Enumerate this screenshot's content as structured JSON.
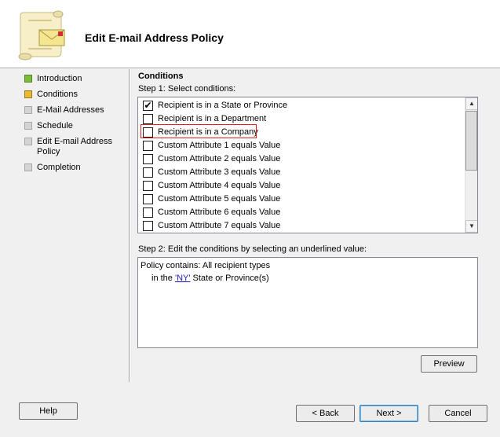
{
  "window": {
    "title": "Edit E-mail Address Policy",
    "header_icon": "scroll-envelope-icon"
  },
  "steps": [
    {
      "label": "Introduction",
      "state": "done"
    },
    {
      "label": "Conditions",
      "state": "current"
    },
    {
      "label": "E-Mail Addresses",
      "state": "pending"
    },
    {
      "label": "Schedule",
      "state": "pending"
    },
    {
      "label": "Edit E-mail Address Policy",
      "state": "pending"
    },
    {
      "label": "Completion",
      "state": "pending"
    }
  ],
  "conditions": {
    "section_title": "Conditions",
    "step1_label": "Step 1: Select conditions:",
    "items": [
      {
        "label": "Recipient is in a State or Province",
        "checked": true
      },
      {
        "label": "Recipient is in a Department",
        "checked": false
      },
      {
        "label": "Recipient is in a Company",
        "checked": false,
        "highlighted": true
      },
      {
        "label": "Custom Attribute 1 equals Value",
        "checked": false
      },
      {
        "label": "Custom Attribute 2 equals Value",
        "checked": false
      },
      {
        "label": "Custom Attribute 3 equals Value",
        "checked": false
      },
      {
        "label": "Custom Attribute 4 equals Value",
        "checked": false
      },
      {
        "label": "Custom Attribute 5 equals Value",
        "checked": false
      },
      {
        "label": "Custom Attribute 6 equals Value",
        "checked": false
      },
      {
        "label": "Custom Attribute 7 equals Value",
        "checked": false
      }
    ],
    "step2_label": "Step 2: Edit the conditions by selecting an underlined value:",
    "description": {
      "line1": "Policy contains: All recipient types",
      "line2_prefix": "in the ",
      "line2_link": "'NY'",
      "line2_suffix": " State or Province(s)"
    }
  },
  "buttons": {
    "preview": "Preview",
    "help": "Help",
    "back": "< Back",
    "next": "Next >",
    "cancel": "Cancel"
  },
  "colors": {
    "highlight_border": "#e02020",
    "link": "#1a1ac8",
    "step_done": "#7dbb3c",
    "step_current": "#e8b838"
  }
}
